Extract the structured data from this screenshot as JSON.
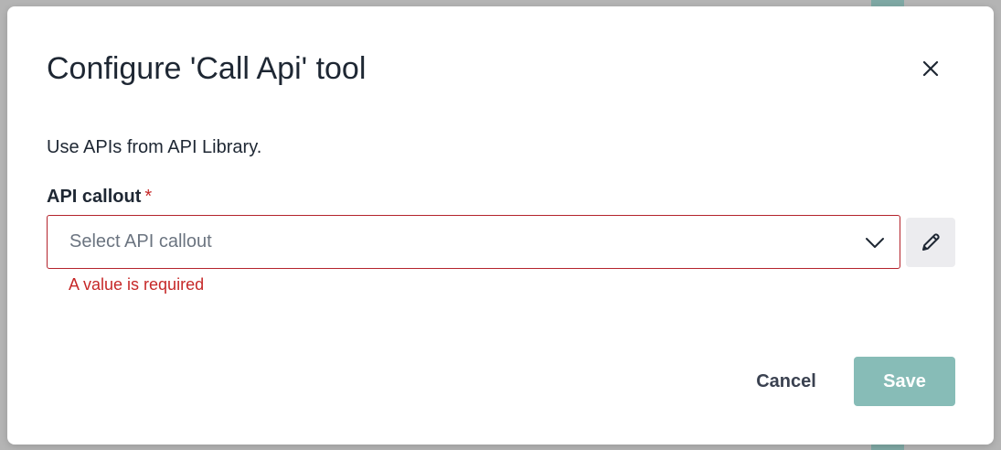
{
  "dialog": {
    "title": "Configure 'Call Api' tool",
    "description": "Use APIs from API Library.",
    "close_icon": "close-icon"
  },
  "field": {
    "label": "API callout",
    "required_marker": "*",
    "placeholder": "Select API callout",
    "error": "A value is required",
    "dropdown_icon": "chevron-down-icon",
    "edit_icon": "pencil-icon"
  },
  "footer": {
    "cancel_label": "Cancel",
    "save_label": "Save"
  },
  "colors": {
    "error": "#c62828",
    "save_button_bg": "#87bcb7",
    "text_primary": "#1e2733"
  }
}
